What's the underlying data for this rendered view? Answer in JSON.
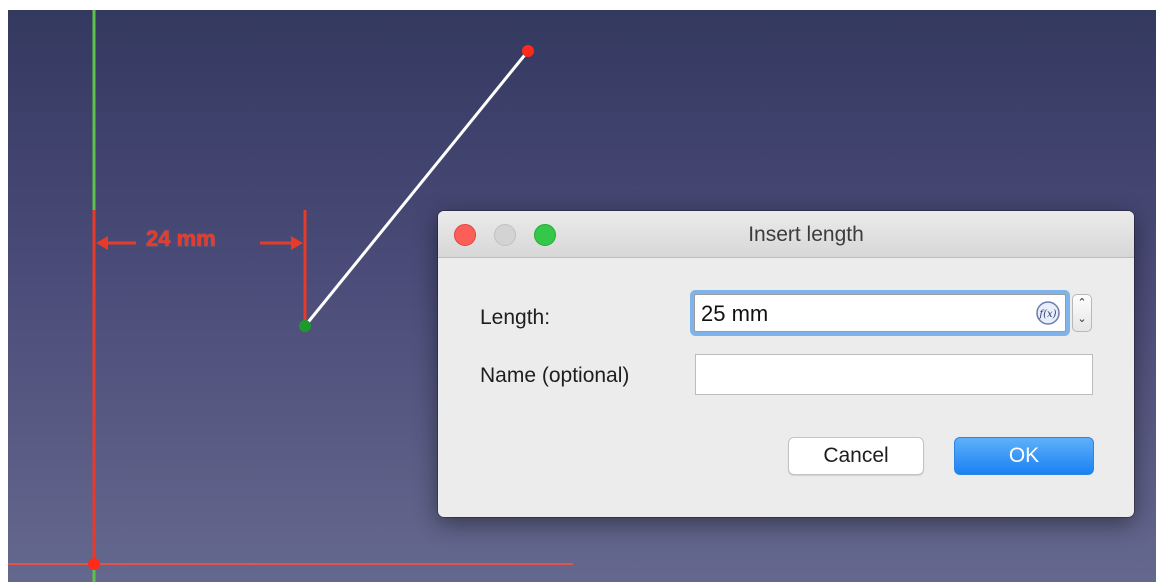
{
  "sketch": {
    "dimension_label": "24 mm"
  },
  "dialog": {
    "title": "Insert length",
    "length_label": "Length:",
    "length_value": "25 mm",
    "name_label": "Name (optional)",
    "name_value": "",
    "cancel_label": "Cancel",
    "ok_label": "OK",
    "expression_icon": "f(x)-icon"
  },
  "colors": {
    "constraint_red": "#e63a2a",
    "axis_green": "#5cc24a",
    "ok_blue": "#1b81f3"
  }
}
